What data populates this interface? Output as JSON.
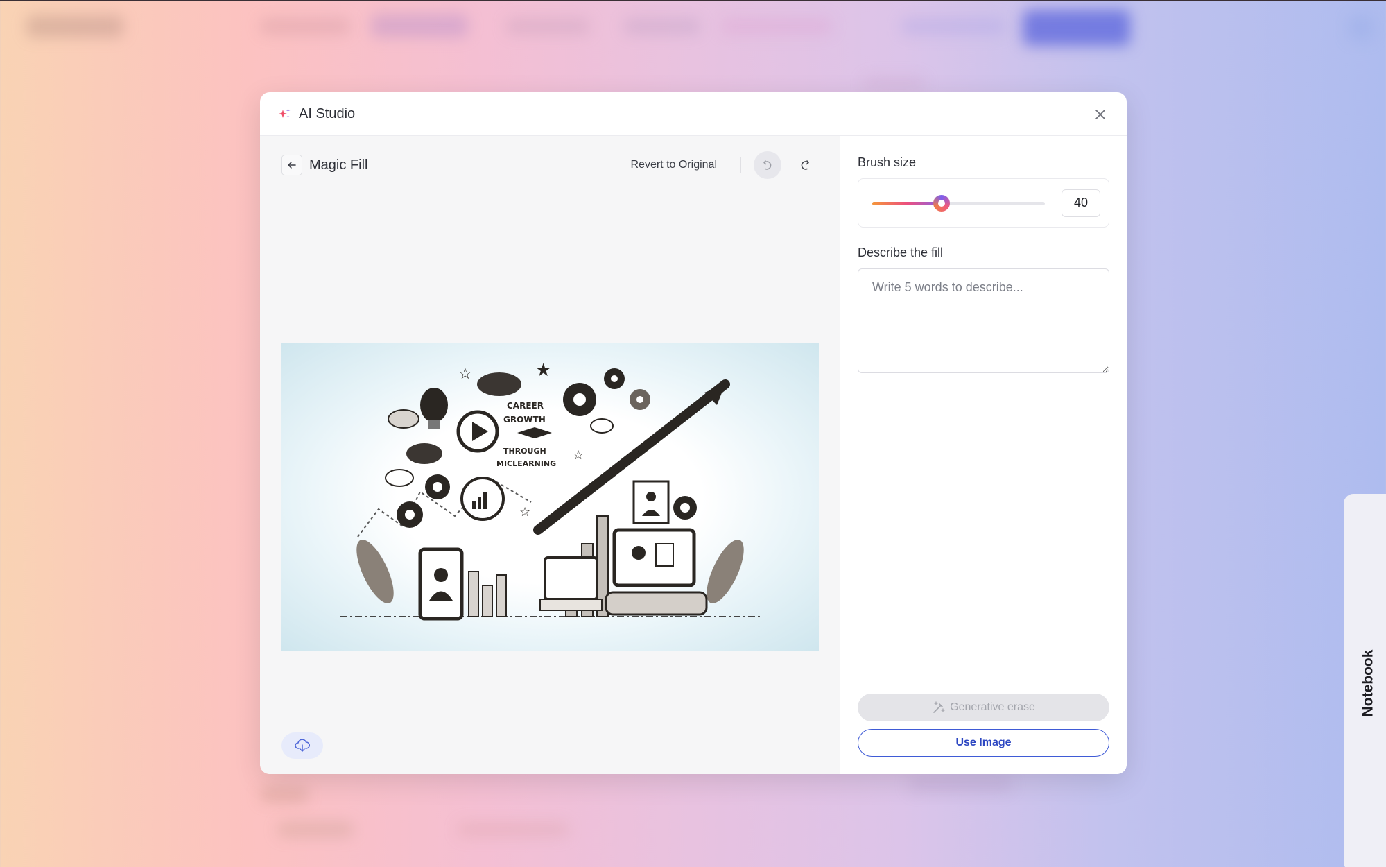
{
  "modal": {
    "title": "AI Studio",
    "icons": {
      "title_icon": "sparkle-icon",
      "close": "close-icon"
    }
  },
  "editor": {
    "tool_title": "Magic Fill",
    "revert_label": "Revert to Original",
    "icons": {
      "back": "arrow-left-icon",
      "undo": "undo-icon",
      "redo": "redo-icon",
      "download": "cloud-download-icon"
    },
    "canvas_image": {
      "description": "Sketch illustration: career growth through microlearning",
      "text_in_image": [
        "CAREER",
        "GROWTH",
        "THROUGH",
        "MICLEARNING"
      ]
    }
  },
  "panel": {
    "brush": {
      "label": "Brush size",
      "value": 40,
      "min": 0,
      "max": 100
    },
    "describe": {
      "label": "Describe the fill",
      "placeholder": "Write 5 words to describe...",
      "value": ""
    },
    "generate_label": "Generative erase",
    "generate_disabled": true,
    "use_image_label": "Use Image"
  },
  "side_tab": {
    "label": "Notebook"
  },
  "colors": {
    "accent": "#3f5bd6",
    "slider_gradient": [
      "#f5963a",
      "#ec4f7e",
      "#8a63e6"
    ],
    "disabled_bg": "#e4e4e8"
  }
}
